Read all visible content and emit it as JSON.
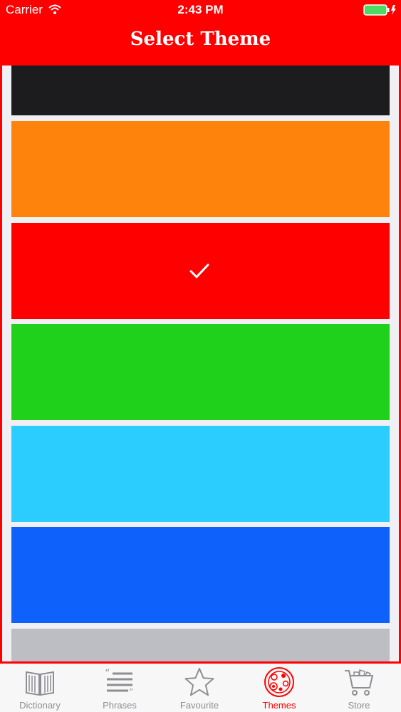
{
  "status_bar": {
    "carrier": "Carrier",
    "time": "2:43 PM",
    "wifi_icon": "wifi-icon",
    "battery_icon": "battery-charging-icon"
  },
  "header": {
    "title": "Select Theme"
  },
  "themes": [
    {
      "color": "#1c1c1e",
      "selected": false
    },
    {
      "color": "#fe830c",
      "selected": false
    },
    {
      "color": "#fe0000",
      "selected": true
    },
    {
      "color": "#1fd11b",
      "selected": false
    },
    {
      "color": "#2acdfd",
      "selected": false
    },
    {
      "color": "#0f61fc",
      "selected": false
    },
    {
      "color": "#bdbec4",
      "selected": false
    }
  ],
  "tab_bar": {
    "tabs": [
      {
        "label": "Dictionary",
        "icon": "book-icon",
        "active": false
      },
      {
        "label": "Phrases",
        "icon": "quote-lines-icon",
        "active": false
      },
      {
        "label": "Favourite",
        "icon": "star-icon",
        "active": false
      },
      {
        "label": "Themes",
        "icon": "palette-icon",
        "active": true
      },
      {
        "label": "Store",
        "icon": "cart-icon",
        "active": false
      }
    ]
  },
  "colors": {
    "accent": "#fe0000",
    "tab_inactive": "#8e8e93",
    "list_background": "#efeff4"
  }
}
